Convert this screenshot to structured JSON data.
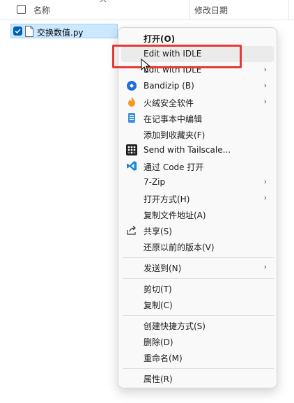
{
  "header": {
    "name_col": "名称",
    "date_col": "修改日期"
  },
  "file": {
    "name": "交换数值.py"
  },
  "menu": {
    "items": [
      {
        "label": "打开(O)",
        "icon": "none"
      },
      {
        "label": "Edit with IDLE",
        "icon": "none"
      },
      {
        "label": "Edit with IDLE",
        "icon": "none",
        "submenu": "›"
      },
      {
        "label": "Bandizip (B)",
        "icon": "bandizip-icon",
        "submenu": "›"
      },
      {
        "label": "火绒安全软件",
        "icon": "huorong-icon",
        "submenu": "›"
      },
      {
        "label": "在记事本中编辑",
        "icon": "notepad-icon"
      },
      {
        "label": "添加到收藏夹(F)",
        "icon": "none"
      },
      {
        "label": "Send with Tailscale...",
        "icon": "tailscale-icon"
      },
      {
        "label": "通过 Code 打开",
        "icon": "vscode-icon"
      },
      {
        "label": "7-Zip",
        "icon": "none",
        "submenu": "›"
      },
      {
        "label": "打开方式(H)",
        "icon": "none",
        "submenu": "›"
      },
      {
        "label": "复制文件地址(A)",
        "icon": "none"
      },
      {
        "label": "共享(S)",
        "icon": "share-icon"
      },
      {
        "label": "还原以前的版本(V)",
        "icon": "none"
      },
      {
        "label": "发送到(N)",
        "icon": "none",
        "submenu": "›"
      },
      {
        "label": "剪切(T)",
        "icon": "none"
      },
      {
        "label": "复制(C)",
        "icon": "none"
      },
      {
        "label": "创建快捷方式(S)",
        "icon": "none"
      },
      {
        "label": "删除(D)",
        "icon": "none"
      },
      {
        "label": "重命名(M)",
        "icon": "none"
      },
      {
        "label": "属性(R)",
        "icon": "none"
      }
    ]
  },
  "colors": {
    "selection_bg": "#cce8ff",
    "accent": "#005fb8",
    "highlight_box": "#e53935"
  }
}
